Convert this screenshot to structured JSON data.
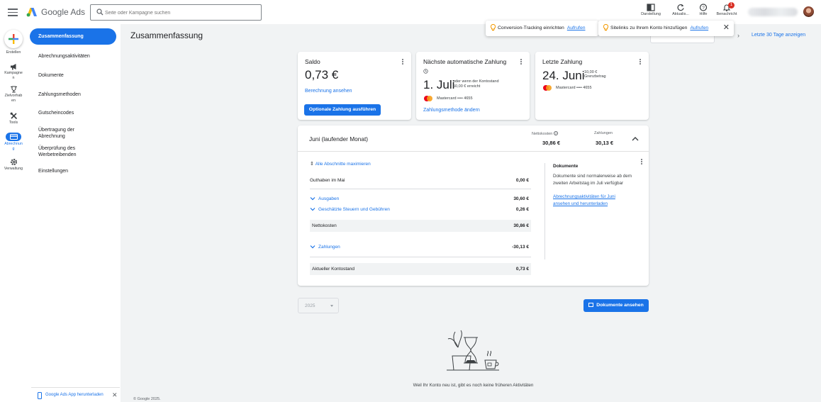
{
  "header": {
    "brand": "Google Ads",
    "search_placeholder": "Seite oder Kampagne suchen",
    "tools": [
      {
        "label": "Darstellung"
      },
      {
        "label": "Aktualis..."
      },
      {
        "label": "Hilfe"
      },
      {
        "label": "Benachricht",
        "badge": "1"
      }
    ]
  },
  "rail": {
    "create_label": "Erstellen",
    "items": [
      {
        "label": "Kampagne\nn"
      },
      {
        "label": "Zielvorhab\nen"
      },
      {
        "label": "Tools"
      },
      {
        "label": "Abrechnun\ng"
      },
      {
        "label": "Verwaltung"
      }
    ]
  },
  "subnav": {
    "items": [
      {
        "label": "Zusammenfassung"
      },
      {
        "label": "Abrechnungsaktivitäten"
      },
      {
        "label": "Dokumente"
      },
      {
        "label": "Zahlungsmethoden"
      },
      {
        "label": "Gutscheincodes"
      },
      {
        "label": "Übertragung der\nAbrechnung"
      },
      {
        "label": "Überprüfung des\nWerbetreibenden"
      },
      {
        "label": "Einstellungen"
      }
    ],
    "app_banner": "Google Ads App herunterladen",
    "copyright": "© Google 2025."
  },
  "page": {
    "title": "Zusammenfassung",
    "range_link": "Letzte 30 Tage anzeigen"
  },
  "toasts": [
    {
      "text": "Conversion-Tracking einrichten",
      "link": "Aufrufen"
    },
    {
      "text": "Sitelinks zu Ihrem Konto hinzufügen",
      "link": "Aufrufen"
    }
  ],
  "cards": {
    "saldo": {
      "title": "Saldo",
      "amount": "0,73 €",
      "link": "Berechnung ansehen",
      "button": "Optionale Zahlung ausführen"
    },
    "next_payment": {
      "title": "Nächste automatische Zahlung",
      "date": "1. Juli",
      "note_line1": "oder wenn der Kontostand",
      "note_line2": "50,00 € erreicht",
      "card": "Mastercard •••• 4655",
      "link": "Zahlungsmethode ändern"
    },
    "last_payment": {
      "title": "Letzte Zahlung",
      "date": "24. Juni",
      "amount_note": "10,00 €",
      "amount_label": "Grenzbetrag",
      "card": "Mastercard •••• 4655"
    }
  },
  "month": {
    "title": "Juni (laufender Monat)",
    "net_cost_label": "Nettokosten",
    "net_cost_value": "30,86 €",
    "payments_label": "Zahlungen",
    "payments_value": "30,13 €",
    "expand_all": "Alle Abschnitte maximieren",
    "rows": [
      {
        "label": "Guthaben im Mai",
        "value": "0,00 €"
      },
      {
        "label": "Ausgaben",
        "value": "30,60 €"
      },
      {
        "label": "Geschätzte Steuern und Gebühren",
        "value": "0,26 €"
      },
      {
        "label": "Nettokosten",
        "value": "30,86 €"
      },
      {
        "label": "Zahlungen",
        "value": "-30,13 €"
      },
      {
        "label": "Aktueller Kontostand",
        "value": "0,73 €"
      }
    ],
    "docs_title": "Dokumente",
    "docs_text": "Dokumente sind normalerweise ab dem zweiten Arbeitstag im Juli verfügbar",
    "docs_link": "Abrechnungsaktivitäten für Juni ansehen und herunterladen"
  },
  "footer": {
    "year": "2025",
    "view_docs_button": "Dokumente ansehen",
    "empty_text": "Weil Ihr Konto neu ist, gibt es noch keine früheren Aktivitäten"
  },
  "colors": {
    "accent": "#1a73e8",
    "background": "#f1f3f4",
    "badge": "#d93025"
  }
}
